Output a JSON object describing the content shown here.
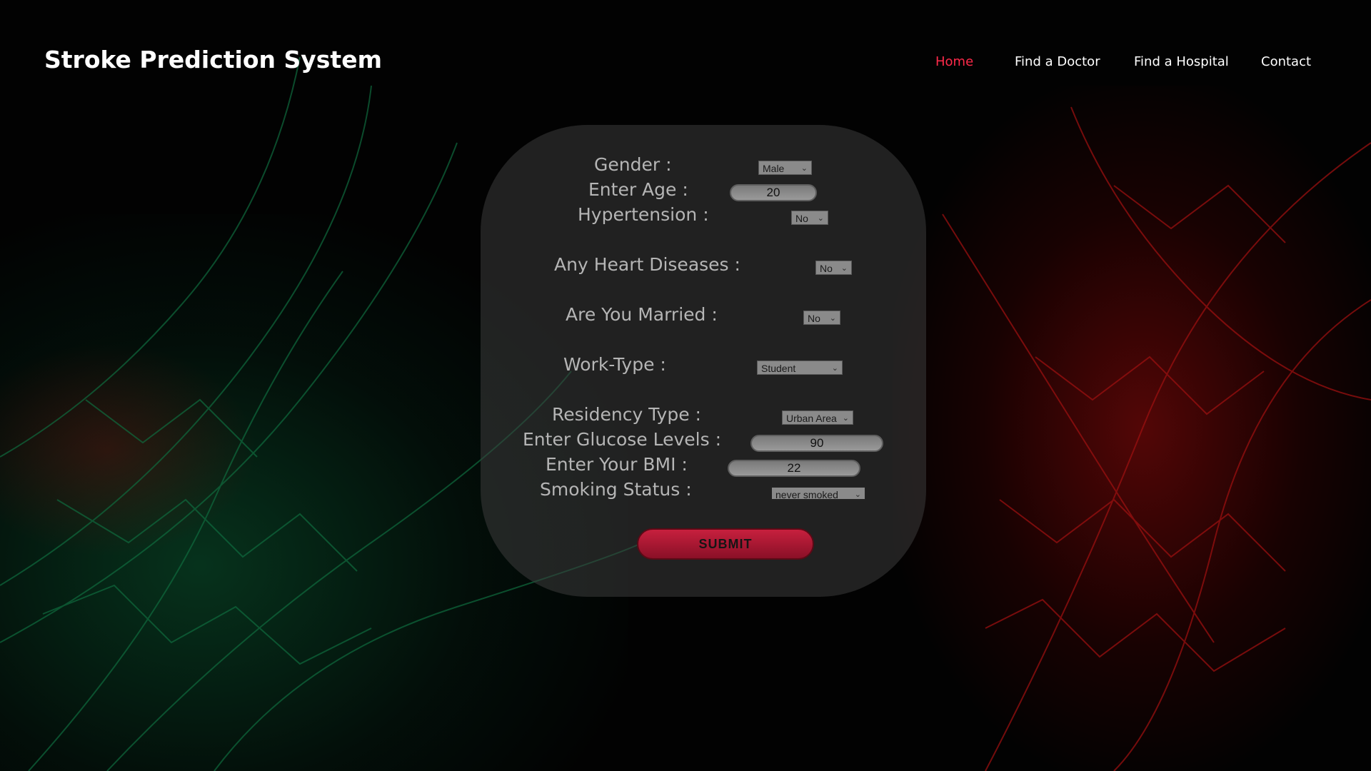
{
  "header": {
    "title": "Stroke Prediction System",
    "nav": {
      "home": "Home",
      "doctor": "Find a Doctor",
      "hospital": "Find a Hospital",
      "contact": "Contact"
    },
    "active_color": "#ff2a4a"
  },
  "form": {
    "gender": {
      "label": "Gender :",
      "value": "Male"
    },
    "age": {
      "label": "Enter Age :",
      "value": "20"
    },
    "hypertension": {
      "label": "Hypertension :",
      "value": "No"
    },
    "heart": {
      "label": "Any Heart Diseases :",
      "value": "No"
    },
    "married": {
      "label": "Are You Married :",
      "value": "No"
    },
    "work": {
      "label": "Work-Type :",
      "value": "Student"
    },
    "residency": {
      "label": "Residency Type :",
      "value": "Urban Area"
    },
    "glucose": {
      "label": "Enter Glucose Levels :",
      "value": "90"
    },
    "bmi": {
      "label": "Enter Your BMI :",
      "value": "22"
    },
    "smoking": {
      "label": "Smoking Status :",
      "value": "never smoked"
    },
    "submit_label": "SUBMIT"
  },
  "icons": {
    "dropdown": "chevron-down-icon"
  },
  "colors": {
    "submit": "#b81a36",
    "panel": "#3c3c3c"
  }
}
